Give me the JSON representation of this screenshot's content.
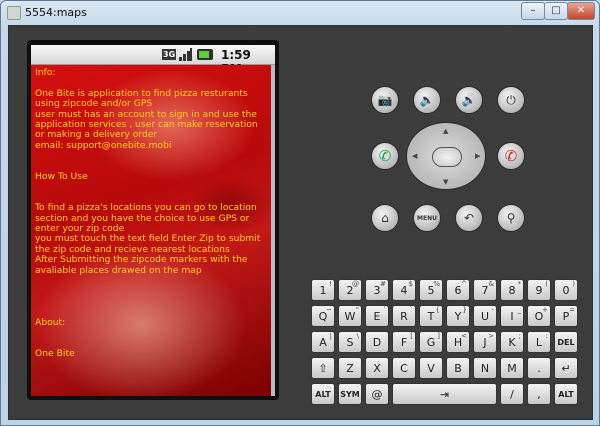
{
  "window": {
    "title": "5554:maps",
    "min": "–",
    "max": "□",
    "close": "✕"
  },
  "status_bar": {
    "network": "3G",
    "time": "1:59 PM"
  },
  "app": {
    "lines": [
      "Info:",
      "",
      "One Bite is application to find pizza resturants",
      "using zipcode and/or GPS",
      "user must has an account to sign in and use the",
      "application services , user can make reservation",
      "or making a delivery order",
      "email: support@onebite.mobi",
      "",
      "",
      "How To Use",
      "",
      "",
      "To find a pizza's locations you can go to location",
      "section and you have the choice to use GPS or",
      "enter your zip code",
      "you must touch the text field Enter Zip to submit",
      "the zip code and recieve nearest locations",
      "After Submitting the zipcode markers with the",
      "avaliable places drawed on the map",
      "",
      "",
      "",
      "",
      "About:",
      "",
      "",
      "One Bite"
    ]
  },
  "controls": {
    "camera": "📷",
    "vol_down": "🔉",
    "vol_up": "🔊",
    "power": "⏻",
    "call": "✆",
    "end_call": "✆",
    "home": "⌂",
    "menu": "MENU",
    "back": "↶",
    "search": "⚲",
    "dpad_up": "▲",
    "dpad_down": "▼",
    "dpad_left": "◀",
    "dpad_right": "▶"
  },
  "keyboard": {
    "row1": [
      {
        "k": "1",
        "a": "!"
      },
      {
        "k": "2",
        "a": "@"
      },
      {
        "k": "3",
        "a": "#"
      },
      {
        "k": "4",
        "a": "$"
      },
      {
        "k": "5",
        "a": "%"
      },
      {
        "k": "6",
        "a": "^"
      },
      {
        "k": "7",
        "a": "&"
      },
      {
        "k": "8",
        "a": "*"
      },
      {
        "k": "9",
        "a": "("
      },
      {
        "k": "0",
        "a": ")"
      }
    ],
    "row2": [
      {
        "k": "Q",
        "a": "~"
      },
      {
        "k": "W",
        "a": "\""
      },
      {
        "k": "E",
        "a": "´"
      },
      {
        "k": "R",
        "a": "`"
      },
      {
        "k": "T",
        "a": "{"
      },
      {
        "k": "Y",
        "a": "}"
      },
      {
        "k": "U",
        "a": "-"
      },
      {
        "k": "I",
        "a": "_"
      },
      {
        "k": "O",
        "a": "+"
      },
      {
        "k": "P",
        "a": "="
      }
    ],
    "row3": [
      {
        "k": "A",
        "a": "|"
      },
      {
        "k": "S",
        "a": "\\"
      },
      {
        "k": "D",
        "a": ""
      },
      {
        "k": "F",
        "a": "["
      },
      {
        "k": "G",
        "a": "]"
      },
      {
        "k": "H",
        "a": "<"
      },
      {
        "k": "J",
        "a": ">"
      },
      {
        "k": "K",
        "a": ";"
      },
      {
        "k": "L",
        "a": ":"
      },
      {
        "k": "DEL",
        "a": ""
      }
    ],
    "row4": [
      {
        "k": "⇧",
        "a": ""
      },
      {
        "k": "Z",
        "a": ""
      },
      {
        "k": "X",
        "a": ""
      },
      {
        "k": "C",
        "a": ""
      },
      {
        "k": "V",
        "a": ""
      },
      {
        "k": "B",
        "a": ""
      },
      {
        "k": "N",
        "a": ""
      },
      {
        "k": "M",
        "a": ""
      },
      {
        "k": ".",
        "a": ""
      },
      {
        "k": "↵",
        "a": ""
      }
    ],
    "row5": {
      "alt_left": "ALT",
      "sym": "SYM",
      "at": "@",
      "space": "",
      "tab": "⇥",
      "slash": "/",
      "comma": ",",
      "alt_right": "ALT"
    }
  }
}
